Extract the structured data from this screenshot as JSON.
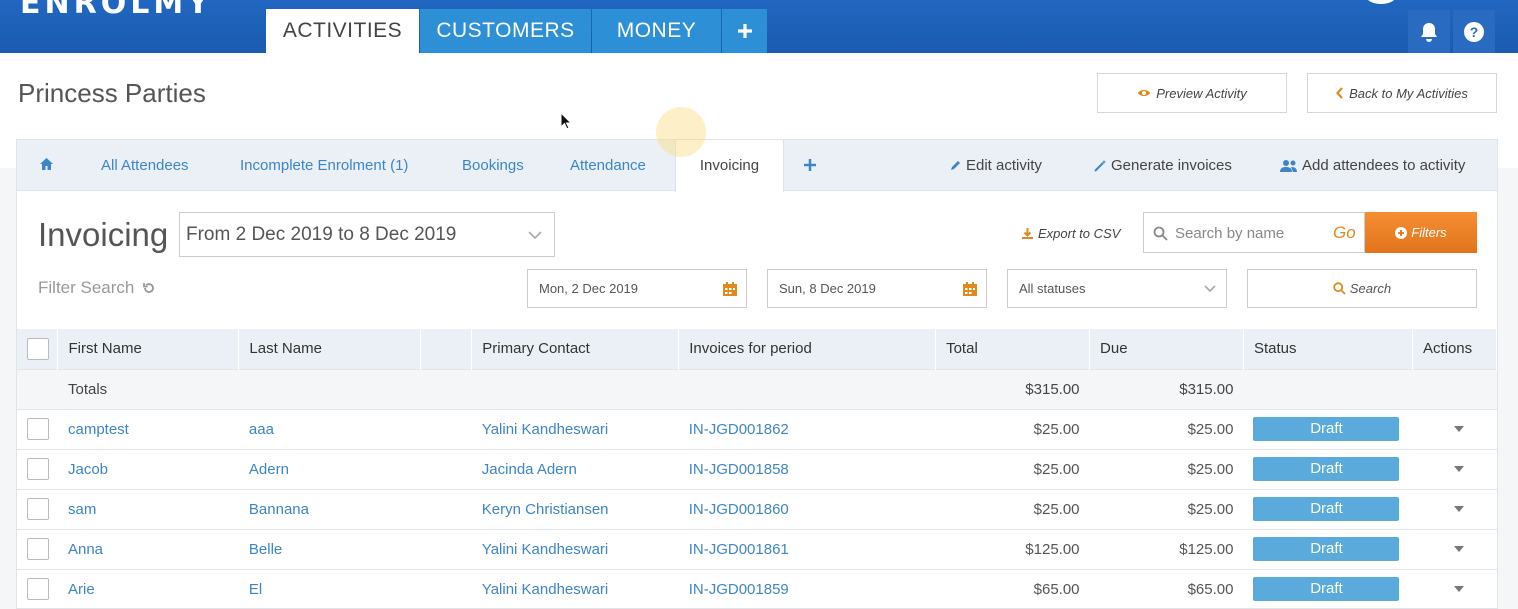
{
  "app": {
    "logo": "ENROLMY",
    "nav_tabs": [
      {
        "label": "ACTIVITIES",
        "active": true
      },
      {
        "label": "CUSTOMERS",
        "active": false
      },
      {
        "label": "MONEY",
        "active": false
      }
    ],
    "add_icon": "plus-icon",
    "bell_icon": "bell-icon",
    "help_icon": "help-icon"
  },
  "page": {
    "title": "Princess Parties",
    "preview_label": "Preview Activity",
    "back_label": "Back to My Activities"
  },
  "tabs": {
    "home_icon": "home-icon",
    "items": [
      "All Attendees",
      "Incomplete Enrolment (1)",
      "Bookings",
      "Attendance",
      "Invoicing"
    ],
    "active": "Invoicing",
    "actions": [
      "Edit activity",
      "Generate invoices",
      "Add attendees to activity"
    ]
  },
  "invoicing": {
    "title": "Invoicing",
    "range_select": "From 2 Dec 2019 to 8 Dec 2019",
    "export_label": "Export to CSV",
    "search_placeholder": "Search by name",
    "go_label": "Go",
    "filters_label": "Filters",
    "filter_search_label": "Filter Search",
    "start_date": "Mon, 2 Dec 2019",
    "end_date": "Sun, 8 Dec 2019",
    "status_select": "All statuses",
    "search_label": "Search"
  },
  "table": {
    "headers": [
      "First Name",
      "Last Name",
      "",
      "Primary Contact",
      "Invoices for period",
      "Total",
      "Due",
      "Status",
      "Actions"
    ],
    "totals": {
      "label": "Totals",
      "total": "$315.00",
      "due": "$315.00"
    },
    "rows": [
      {
        "first": "camptest",
        "last": "aaa",
        "contact": "Yalini Kandheswari",
        "invoice": "IN-JGD001862",
        "total": "$25.00",
        "due": "$25.00",
        "status": "Draft"
      },
      {
        "first": "Jacob",
        "last": "Adern",
        "contact": "Jacinda Adern",
        "invoice": "IN-JGD001858",
        "total": "$25.00",
        "due": "$25.00",
        "status": "Draft"
      },
      {
        "first": "sam",
        "last": "Bannana",
        "contact": "Keryn Christiansen",
        "invoice": "IN-JGD001860",
        "total": "$25.00",
        "due": "$25.00",
        "status": "Draft"
      },
      {
        "first": "Anna",
        "last": "Belle",
        "contact": "Yalini Kandheswari",
        "invoice": "IN-JGD001861",
        "total": "$125.00",
        "due": "$125.00",
        "status": "Draft"
      },
      {
        "first": "Arie",
        "last": "El",
        "contact": "Yalini Kandheswari",
        "invoice": "IN-JGD001859",
        "total": "$65.00",
        "due": "$65.00",
        "status": "Draft"
      }
    ]
  },
  "colors": {
    "brand_blue": "#1a5bb0",
    "tab_blue": "#2d8fd6",
    "link": "#3d85c6",
    "accent_orange": "#f0822a",
    "draft_badge": "#5aabdc"
  }
}
